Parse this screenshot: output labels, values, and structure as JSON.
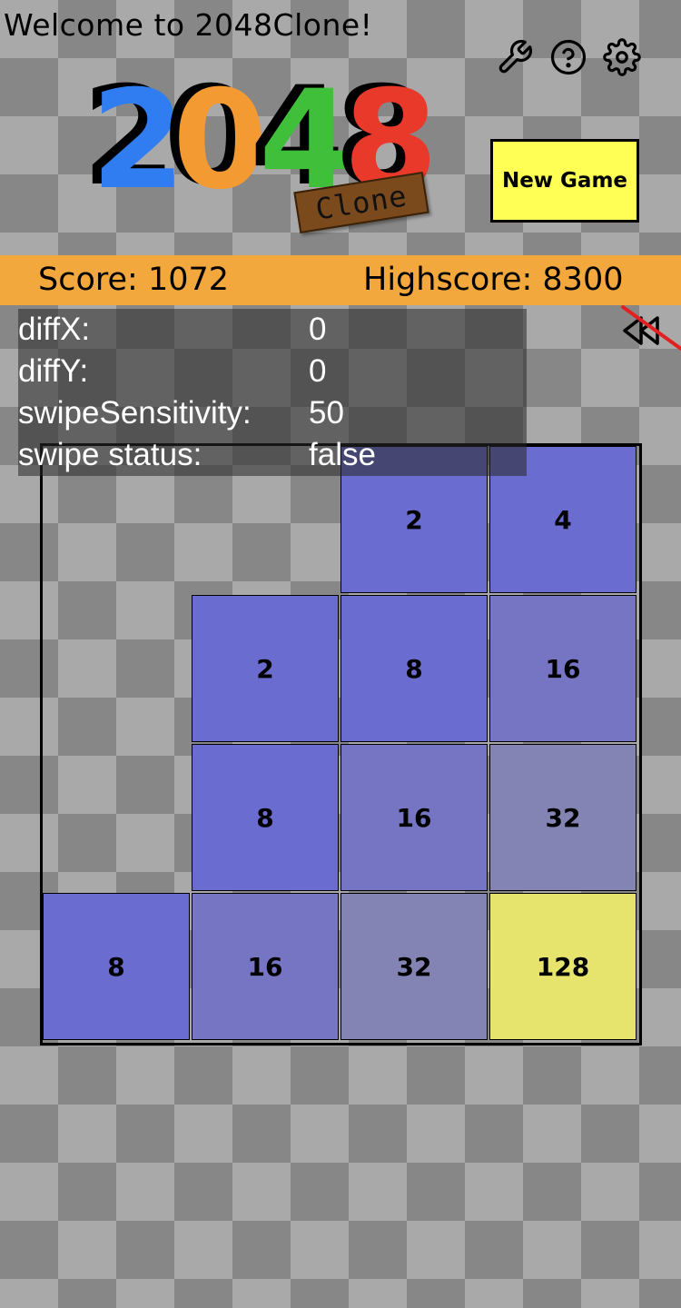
{
  "header": {
    "welcome": "Welcome to 2048Clone!",
    "icons": [
      "wrench-icon",
      "help-icon",
      "gear-icon"
    ],
    "new_game_label": "New Game"
  },
  "logo": {
    "digits": [
      {
        "char": "2",
        "color": "#2f7df0"
      },
      {
        "char": "0",
        "color": "#f39a32"
      },
      {
        "char": "4",
        "color": "#3fbf3a"
      },
      {
        "char": "8",
        "color": "#e8392a"
      }
    ],
    "badge": "Clone"
  },
  "scores": {
    "score_text": "Score: 1072",
    "highscore_text": "Highscore: 8300"
  },
  "debug": [
    {
      "key": "diffX:",
      "value": "0"
    },
    {
      "key": "diffY:",
      "value": "0"
    },
    {
      "key": "swipeSensitivity:",
      "value": "50"
    },
    {
      "key": "swipe status:",
      "value": "false"
    }
  ],
  "board": {
    "rows": [
      [
        null,
        null,
        2,
        4
      ],
      [
        null,
        2,
        8,
        16
      ],
      [
        null,
        8,
        16,
        32
      ],
      [
        8,
        16,
        32,
        128
      ]
    ]
  },
  "colors": {
    "score_bar": "#f2a83c",
    "new_game_bg": "#ffff55",
    "tile_2": "#6a6ccf",
    "tile_4": "#6a6ccf",
    "tile_8": "#6a6ccf",
    "tile_16": "#7575c4",
    "tile_32": "#8484b4",
    "tile_128": "#e6e46c"
  }
}
